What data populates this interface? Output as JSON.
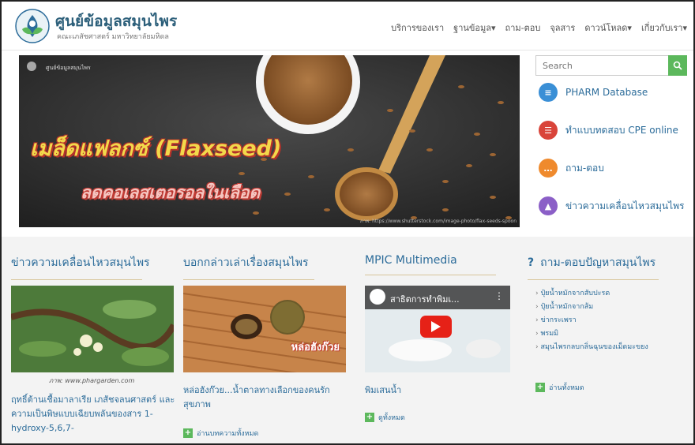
{
  "header": {
    "title": "ศูนย์ข้อมูลสมุนไพร",
    "subtitle": "คณะเภสัชศาสตร์ มหาวิทยาลัยมหิดล",
    "nav": [
      "บริการของเรา",
      "ฐานข้อมูล",
      "ถาม-ตอบ",
      "จุลสาร",
      "ดาวน์โหลด",
      "เกี่ยวกับเรา"
    ]
  },
  "hero": {
    "tag": "ศูนย์ข้อมูลสมุนไพร",
    "title": "เมล็ดแฟลกซ์ (Flaxseed)",
    "subtitle": "ลดคอเลสเตอรอลในเลือด",
    "credit": "ภาพ: https://www.shutterstock.com/image-photo/flax-seeds-spoon"
  },
  "search": {
    "placeholder": "Search",
    "button_icon": "search-icon"
  },
  "side_links": [
    {
      "label": "PHARM Database",
      "icon": "database-icon",
      "color": "#3a8fd6"
    },
    {
      "label": "ทำแบบทดสอบ CPE online",
      "icon": "clipboard-icon",
      "color": "#d9443a"
    },
    {
      "label": "ถาม-ตอบ",
      "icon": "chat-icon",
      "color": "#ef8a2d"
    },
    {
      "label": "ข่าวความเคลื่อนไหวสมุนไพร",
      "icon": "flask-icon",
      "color": "#8b5fc7"
    }
  ],
  "columns": {
    "news": {
      "title": "ข่าวความเคลื่อนไหวสมุนไพร",
      "caption": "ภาพ: www.phargarden.com",
      "text": "ฤทธิ์ต้านเชื้อมาลาเรีย เภสัชจลนศาสตร์ และความเป็นพิษแบบเฉียบพลันของสาร 1-hydroxy-5,6,7-"
    },
    "stories": {
      "title": "บอกกล่าวเล่าเรื่องสมุนไพร",
      "thumb_text": "หล่อฮังก๊วย",
      "text": "หล่อฮังก๊วย...น้ำตาลทางเลือกของคนรักสุขภาพ",
      "more": "อ่านบทความทั้งหมด"
    },
    "multimedia": {
      "title": "MPIC Multimedia",
      "video_title": "สาธิตการทำพิมเ...",
      "text": "พิมเสนน้ำ",
      "more": "ดูทั้งหมด"
    },
    "qa": {
      "title": "ถาม-ตอบปัญหาสมุนไพร",
      "items": [
        "ปุ๋ยน้ำหมักจากสับปะรด",
        "ปุ๋ยน้ำหมักจากส้ม",
        "ข่ากระเพรา",
        "พรมมิ",
        "สมุนไพรกลบกลิ่นฉุนของเม็ดมะขยง"
      ],
      "more": "อ่านทั้งหมด"
    }
  }
}
